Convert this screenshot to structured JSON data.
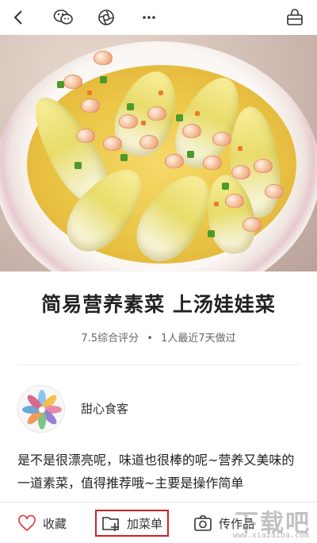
{
  "nav": {
    "icons": [
      "back-icon",
      "wechat-icon",
      "moments-icon",
      "more-icon",
      "basket-icon"
    ]
  },
  "recipe": {
    "title": "简易营养素菜 上汤娃娃菜",
    "rating": "7.5综合评分",
    "separator": "•",
    "cooked": "1人最近7天做过"
  },
  "author": {
    "name": "甜心食客"
  },
  "description": "是不是很漂亮呢，味道也很棒的呢~营养又美味的一道素菜，值得推荐哦~主要是操作简单",
  "bottom_bar": {
    "favorite_label": "收藏",
    "add_menu_label": "加菜单",
    "post_work_label": "传作品"
  },
  "watermark": {
    "big": "下载吧",
    "small": "www.xiazaiba.com"
  },
  "colors": {
    "highlight_border": "#d0202a",
    "favorite_icon": "#e04a4a"
  }
}
